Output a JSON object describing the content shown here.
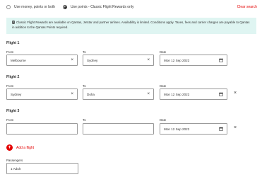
{
  "fare_options": {
    "money": {
      "label": "Use money, points or both",
      "selected": false
    },
    "points": {
      "label": "Use points - Classic Flight Rewards only",
      "selected": true
    }
  },
  "clear_search": "Clear search",
  "notice": {
    "icon": "info-icon",
    "text": "Classic Flight Rewards are available on Qantas, Jetstar and partner airlines. Availability is limited. Conditions apply. Taxes, fees and carrier charges are payable to Qantas in addition to the Qantas Points required."
  },
  "labels": {
    "from": "From",
    "to": "To",
    "date": "Date"
  },
  "flights": [
    {
      "title": "Flight 1",
      "from": "Melbourne",
      "to": "Sydney",
      "date": "Mon 12 Sep 2022"
    },
    {
      "title": "Flight 2",
      "from": "Sydney",
      "to": "Doha",
      "date": "Mon 12 Sep 2022"
    },
    {
      "title": "Flight 3",
      "from": "",
      "to": "",
      "date": "Mon 12 Sep 2022"
    }
  ],
  "add_flight": "Add a flight",
  "passengers": {
    "label": "Passengers",
    "value": "1 Adult"
  },
  "colors": {
    "accent": "#e40000",
    "notice_bg": "#dff5f2"
  }
}
